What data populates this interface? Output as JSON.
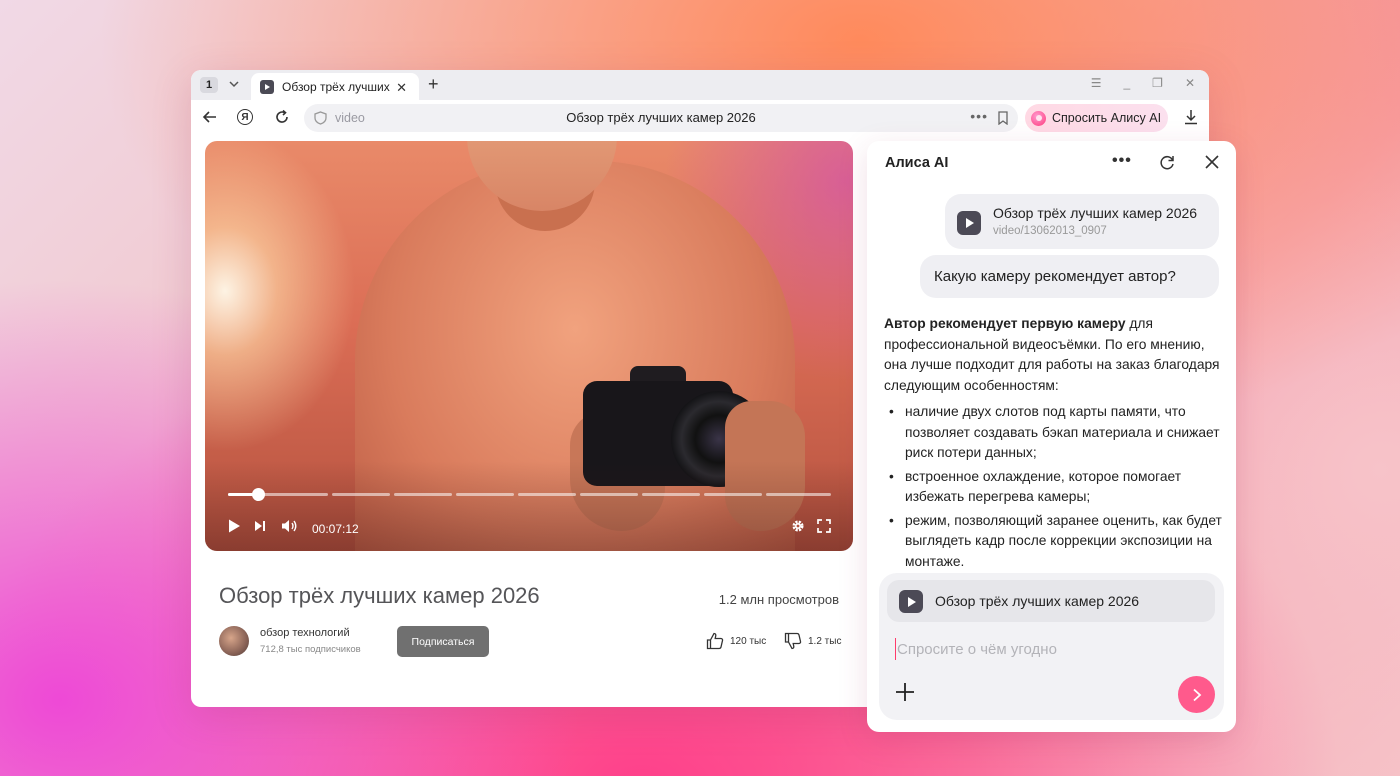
{
  "browser": {
    "tab_count": "1",
    "tab_title": "Обзор трёх лучших",
    "address_host": "video",
    "address_title": "Обзор трёх лучших камер 2026",
    "alice_button": "Спросить Алису AI"
  },
  "video": {
    "time": "00:07:12",
    "progress_fraction": 0.05,
    "title": "Обзор трёх лучших камер 2026",
    "views": "1.2 млн просмотров",
    "channel_name": "обзор технологий",
    "channel_subs": "712,8 тыс подписчиков",
    "subscribe_label": "Подписаться",
    "likes": "120 тыс",
    "dislikes": "1.2 тыс"
  },
  "panel": {
    "title": "Алиса AI",
    "attachment_title": "Обзор трёх лучших камер 2026",
    "attachment_sub": "video/13062013_0907",
    "question": "Какую камеру рекомендует автор?",
    "answer_bold": "Автор рекомендует первую камеру",
    "answer_rest": " для профессиональной видеосъёмки. По его мнению, она лучше подходит для работы на заказ благодаря следующим особенностям:",
    "answer_points": [
      "наличие двух слотов под карты памяти, что позволяет создавать бэкап материала и снижает риск потери данных;",
      "встроенное охлаждение, которое помогает избежать перегрева камеры;",
      "режим, позволяющий заранее оценить, как будет выглядеть кадр после коррекции экспозиции на монтаже."
    ],
    "input_chip": "Обзор трёх лучших камер 2026",
    "input_placeholder": "Спросите о чём угодно"
  },
  "colors": {
    "send_button": "#ff5a8c",
    "alice_accent": "#ff3b7c"
  }
}
